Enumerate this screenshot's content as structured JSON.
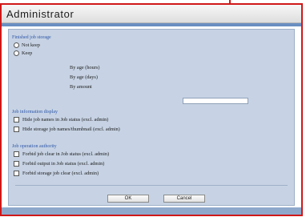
{
  "window": {
    "title": "Administrator"
  },
  "finished_job_storage": {
    "heading": "Finished job storage",
    "options": [
      {
        "label": "Not keep",
        "selected": false
      },
      {
        "label": "Keep",
        "selected": false
      }
    ],
    "sub_options": [
      "By age (hours)",
      "By age (days)",
      "By amount"
    ],
    "amount_value": ""
  },
  "job_information_display": {
    "heading": "Job information display",
    "checkboxes": [
      {
        "label": "Hide job names in Job status (excl. admin)",
        "checked": false
      },
      {
        "label": "Hide storage job names/thumbnail (excl. admin)",
        "checked": false
      }
    ]
  },
  "job_operation_authority": {
    "heading": "Job operation authority",
    "checkboxes": [
      {
        "label": "Forbid job clear in Job status (excl. admin)",
        "checked": false
      },
      {
        "label": "Forbid output in Job status (excl. admin)",
        "checked": false
      },
      {
        "label": "Forbid storage job clear (excl. admin)",
        "checked": false
      }
    ]
  },
  "buttons": {
    "ok": "OK",
    "cancel": "Cancel"
  },
  "colors": {
    "highlight_border": "#d01818",
    "panel_bg": "#c7d3e4",
    "heading_text": "#2d56a8",
    "accent_strip": "#6a8fc2"
  }
}
